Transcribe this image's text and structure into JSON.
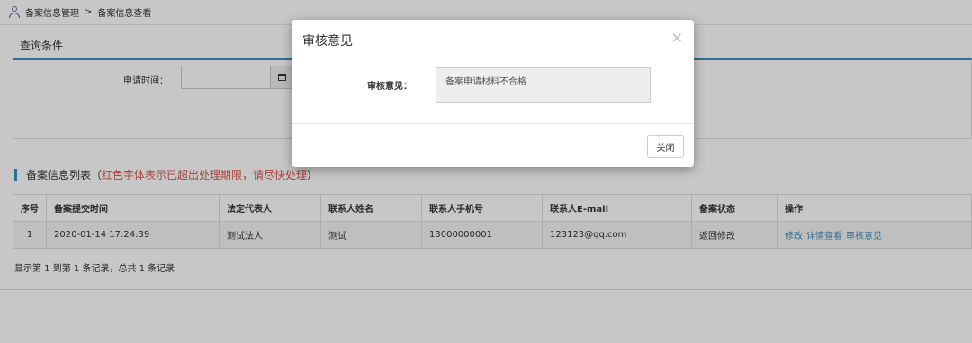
{
  "breadcrumb": {
    "parent": "备案信息管理",
    "separator": ">",
    "current": "备案信息查看"
  },
  "query": {
    "title": "查询条件",
    "apply_time_label": "申请时间：",
    "apply_time_value": ""
  },
  "list": {
    "title": "备案信息列表（",
    "warning": "红色字体表示已超出处理期限，请尽快处理",
    "title_end": "）",
    "columns": [
      "序号",
      "备案提交时间",
      "法定代表人",
      "联系人姓名",
      "联系人手机号",
      "联系人E-mail",
      "备案状态",
      "操作"
    ],
    "rows": [
      {
        "index": "1",
        "submit_time": "2020-01-14 17:24:39",
        "legal_rep": "测试法人",
        "contact_name": "测试",
        "phone": "13000000001",
        "email": "123123@qq.com",
        "status": "返回修改",
        "actions": [
          "修改",
          "详情查看",
          "审核意见"
        ]
      }
    ],
    "pager_text": "显示第 1 到第 1 条记录，总共 1 条记录"
  },
  "modal": {
    "title": "审核意见",
    "close_icon": "×",
    "field_label": "审核意见：",
    "field_value": "备案申请材料不合格",
    "close_button": "关闭"
  },
  "colors": {
    "accent": "#3c8dbc",
    "warning": "#d9534f",
    "icon": "#6d5fa8"
  }
}
